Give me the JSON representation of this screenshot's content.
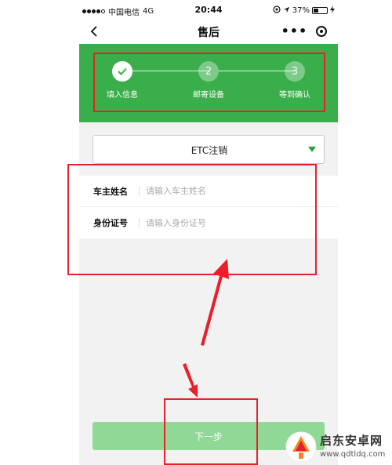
{
  "status_bar": {
    "carrier": "中国电信",
    "network": "4G",
    "time": "20:44",
    "battery": "37%",
    "battery_level": 0.37
  },
  "nav": {
    "title": "售后",
    "more_icon": "ellipsis-icon",
    "close_icon": "target-icon",
    "back_icon": "chevron-left-icon"
  },
  "steps": [
    {
      "index": "1",
      "label": "填入信息",
      "state": "done"
    },
    {
      "index": "2",
      "label": "邮寄设备",
      "state": "todo"
    },
    {
      "index": "3",
      "label": "等到确认",
      "state": "todo"
    }
  ],
  "service_select": {
    "value": "ETC注销"
  },
  "form": {
    "fields": [
      {
        "label": "车主姓名",
        "placeholder": "请输入车主姓名",
        "value": ""
      },
      {
        "label": "身份证号",
        "placeholder": "请输入身份证号",
        "value": ""
      }
    ]
  },
  "next_button": {
    "label": "下一步"
  },
  "watermark": {
    "name": "启东安卓网",
    "url": "www.qdtldq.com"
  },
  "colors": {
    "primary_green": "#3aae4a",
    "button_green_disabled": "#8fd896",
    "annotation_red": "#e8202a"
  }
}
